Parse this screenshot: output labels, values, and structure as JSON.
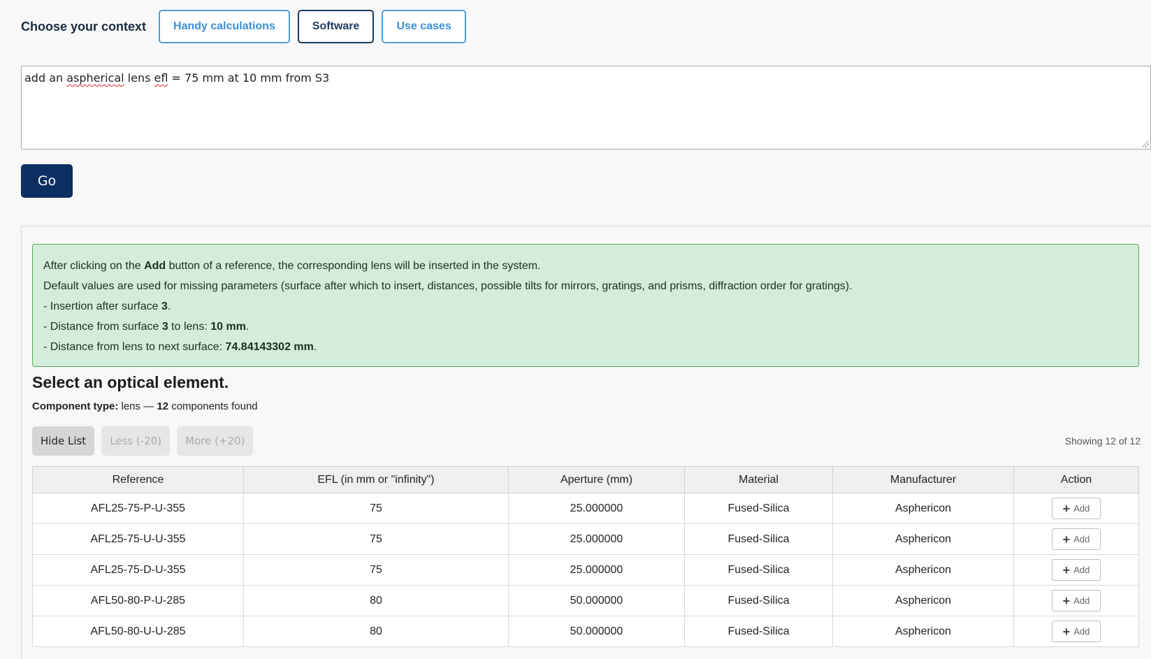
{
  "context": {
    "label": "Choose your context",
    "buttons": [
      {
        "label": "Handy calculations",
        "active": false
      },
      {
        "label": "Software",
        "active": true
      },
      {
        "label": "Use cases",
        "active": false
      }
    ]
  },
  "query": {
    "pre1": "add an ",
    "word1": "aspherical",
    "mid": " lens ",
    "word2": "efl",
    "post": " = 75 mm at 10 mm from S3"
  },
  "go_label": "Go",
  "alert": {
    "line1_pre": "After clicking on the ",
    "line1_bold": "Add",
    "line1_post": " button of a reference, the corresponding lens will be inserted in the system.",
    "line2": "Default values are used for missing parameters (surface after which to insert, distances, possible tilts for mirrors, gratings, and prisms, diffraction order for gratings).",
    "line3_pre": "- Insertion after surface ",
    "line3_bold": "3",
    "line3_post": ".",
    "line4_pre": "- Distance from surface ",
    "line4_bold1": "3",
    "line4_mid": " to lens: ",
    "line4_bold2": "10 mm",
    "line4_post": ".",
    "line5_pre": "- Distance from lens to next surface: ",
    "line5_bold": "74.84143302 mm",
    "line5_post": "."
  },
  "selection": {
    "title": "Select an optical element.",
    "type_label": "Component type:",
    "type_value": " lens — ",
    "count": "12",
    "found_text": " components found"
  },
  "controls": {
    "hide": "Hide List",
    "less": "Less (-20)",
    "more": "More (+20)",
    "showing": "Showing 12 of 12"
  },
  "table": {
    "headers": [
      "Reference",
      "EFL (in mm or \"infinity\")",
      "Aperture (mm)",
      "Material",
      "Manufacturer",
      "Action"
    ],
    "add_label": "Add",
    "rows": [
      {
        "reference": "AFL25-75-P-U-355",
        "efl": "75",
        "aperture": "25.000000",
        "material": "Fused-Silica",
        "manufacturer": "Asphericon"
      },
      {
        "reference": "AFL25-75-U-U-355",
        "efl": "75",
        "aperture": "25.000000",
        "material": "Fused-Silica",
        "manufacturer": "Asphericon"
      },
      {
        "reference": "AFL25-75-D-U-355",
        "efl": "75",
        "aperture": "25.000000",
        "material": "Fused-Silica",
        "manufacturer": "Asphericon"
      },
      {
        "reference": "AFL50-80-P-U-285",
        "efl": "80",
        "aperture": "50.000000",
        "material": "Fused-Silica",
        "manufacturer": "Asphericon"
      },
      {
        "reference": "AFL50-80-U-U-285",
        "efl": "80",
        "aperture": "50.000000",
        "material": "Fused-Silica",
        "manufacturer": "Asphericon"
      }
    ]
  }
}
